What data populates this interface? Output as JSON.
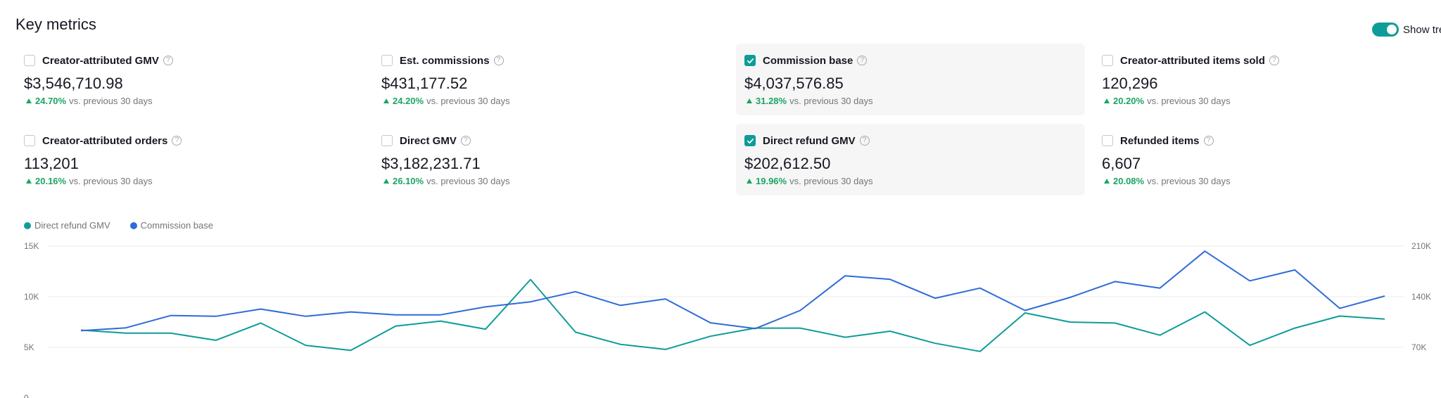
{
  "page_title": "Key metrics",
  "trend_toggle": {
    "label": "Show tre",
    "on": true
  },
  "metrics": [
    {
      "label": "Creator-attributed GMV",
      "value": "$3,546,710.98",
      "change": "24.70%",
      "compare": "vs. previous 30 days",
      "checked": false
    },
    {
      "label": "Est. commissions",
      "value": "$431,177.52",
      "change": "24.20%",
      "compare": "vs. previous 30 days",
      "checked": false
    },
    {
      "label": "Commission base",
      "value": "$4,037,576.85",
      "change": "31.28%",
      "compare": "vs. previous 30 days",
      "checked": true
    },
    {
      "label": "Creator-attributed items sold",
      "value": "120,296",
      "change": "20.20%",
      "compare": "vs. previous 30 days",
      "checked": false
    },
    {
      "label": "Creator-attributed orders",
      "value": "113,201",
      "change": "20.16%",
      "compare": "vs. previous 30 days",
      "checked": false
    },
    {
      "label": "Direct GMV",
      "value": "$3,182,231.71",
      "change": "26.10%",
      "compare": "vs. previous 30 days",
      "checked": false
    },
    {
      "label": "Direct refund GMV",
      "value": "$202,612.50",
      "change": "19.96%",
      "compare": "vs. previous 30 days",
      "checked": true
    },
    {
      "label": "Refunded items",
      "value": "6,607",
      "change": "20.08%",
      "compare": "vs. previous 30 days",
      "checked": false
    }
  ],
  "colors": {
    "teal": "#0e9c99",
    "blue": "#2f6bd8",
    "up": "#1aa563"
  },
  "chart_data": {
    "type": "line",
    "legend": [
      "Direct refund GMV",
      "Commission base"
    ],
    "y_left_ticks": [
      "15K",
      "10K",
      "5K",
      "0"
    ],
    "y_right_ticks": [
      "210K",
      "140K",
      "70K"
    ],
    "ylim_left": [
      0,
      15000
    ],
    "ylim_right": [
      0,
      210000
    ],
    "series": [
      {
        "name": "Direct refund GMV",
        "axis": "left",
        "color": "#0e9c99",
        "values": [
          6700,
          6400,
          6400,
          5700,
          7400,
          5200,
          4700,
          7100,
          7600,
          6800,
          11700,
          6500,
          5300,
          4800,
          6100,
          6900,
          6900,
          6000,
          6600,
          5400,
          4600,
          8400,
          7500,
          7400,
          6200,
          8500,
          5200,
          6900,
          8100,
          7800
        ]
      },
      {
        "name": "Commission base",
        "axis": "right",
        "color": "#2f6bd8",
        "values": [
          93000,
          97000,
          114000,
          113000,
          123000,
          113000,
          119000,
          115000,
          115000,
          126000,
          133000,
          147000,
          128000,
          137000,
          104000,
          96000,
          121000,
          169000,
          164000,
          138000,
          152000,
          121000,
          139000,
          161000,
          152000,
          203000,
          162000,
          177000,
          124000,
          141000
        ]
      }
    ]
  }
}
